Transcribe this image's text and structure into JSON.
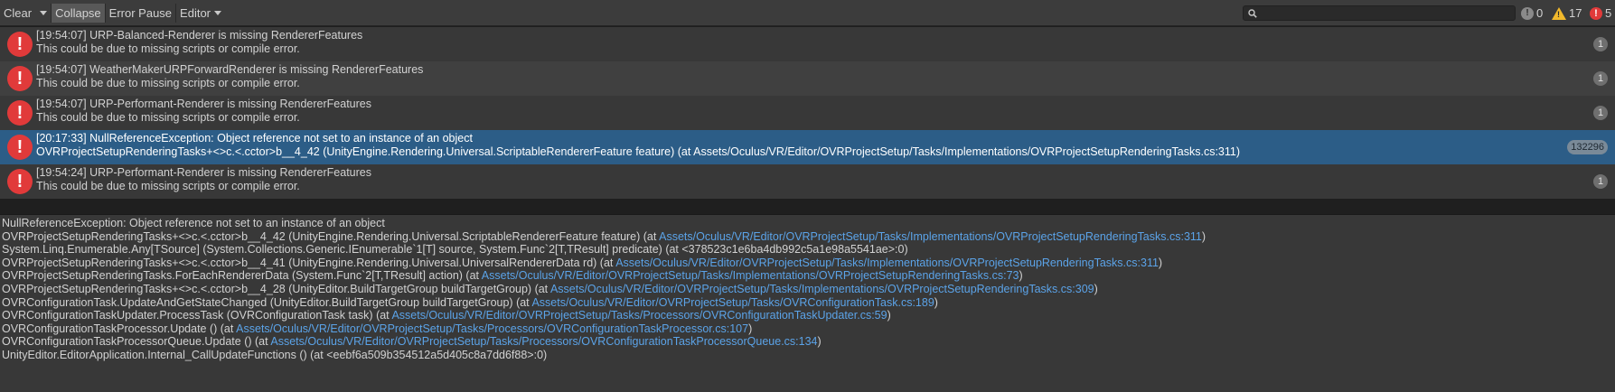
{
  "toolbar": {
    "clear_label": "Clear",
    "collapse_label": "Collapse",
    "error_pause_label": "Error Pause",
    "editor_label": "Editor",
    "search": {
      "value": "",
      "placeholder": ""
    },
    "counts": {
      "info": "0",
      "warnings": "17",
      "errors": "5"
    }
  },
  "logs": [
    {
      "line1": "[19:54:07] URP-Balanced-Renderer is missing RendererFeatures",
      "line2": "This could be due to missing scripts or compile error.",
      "count": "1",
      "selected": false
    },
    {
      "line1": "[19:54:07] WeatherMakerURPForwardRenderer is missing RendererFeatures",
      "line2": "This could be due to missing scripts or compile error.",
      "count": "1",
      "selected": false
    },
    {
      "line1": "[19:54:07] URP-Performant-Renderer is missing RendererFeatures",
      "line2": "This could be due to missing scripts or compile error.",
      "count": "1",
      "selected": false
    },
    {
      "line1": "[20:17:33] NullReferenceException: Object reference not set to an instance of an object",
      "line2": "OVRProjectSetupRenderingTasks+<>c.<.cctor>b__4_42 (UnityEngine.Rendering.Universal.ScriptableRendererFeature feature) (at Assets/Oculus/VR/Editor/OVRProjectSetup/Tasks/Implementations/OVRProjectSetupRenderingTasks.cs:311)",
      "count": "132296",
      "selected": true
    },
    {
      "line1": "[19:54:24] URP-Performant-Renderer is missing RendererFeatures",
      "line2": "This could be due to missing scripts or compile error.",
      "count": "1",
      "selected": false
    }
  ],
  "detail": [
    {
      "text": "NullReferenceException: Object reference not set to an instance of an object",
      "link": "",
      "suffix": ""
    },
    {
      "text": "OVRProjectSetupRenderingTasks+<>c.<.cctor>b__4_42 (UnityEngine.Rendering.Universal.ScriptableRendererFeature feature) (at ",
      "link": "Assets/Oculus/VR/Editor/OVRProjectSetup/Tasks/Implementations/OVRProjectSetupRenderingTasks.cs:311",
      "suffix": ")"
    },
    {
      "text": "System.Linq.Enumerable.Any[TSource] (System.Collections.Generic.IEnumerable`1[T] source, System.Func`2[T,TResult] predicate) (at <378523c1e6ba4db992c5a1e98a5541ae>:0)",
      "link": "",
      "suffix": ""
    },
    {
      "text": "OVRProjectSetupRenderingTasks+<>c.<.cctor>b__4_41 (UnityEngine.Rendering.Universal.UniversalRendererData rd) (at ",
      "link": "Assets/Oculus/VR/Editor/OVRProjectSetup/Tasks/Implementations/OVRProjectSetupRenderingTasks.cs:311",
      "suffix": ")"
    },
    {
      "text": "OVRProjectSetupRenderingTasks.ForEachRendererData (System.Func`2[T,TResult] action) (at ",
      "link": "Assets/Oculus/VR/Editor/OVRProjectSetup/Tasks/Implementations/OVRProjectSetupRenderingTasks.cs:73",
      "suffix": ")"
    },
    {
      "text": "OVRProjectSetupRenderingTasks+<>c.<.cctor>b__4_28 (UnityEditor.BuildTargetGroup buildTargetGroup) (at ",
      "link": "Assets/Oculus/VR/Editor/OVRProjectSetup/Tasks/Implementations/OVRProjectSetupRenderingTasks.cs:309",
      "suffix": ")"
    },
    {
      "text": "OVRConfigurationTask.UpdateAndGetStateChanged (UnityEditor.BuildTargetGroup buildTargetGroup) (at ",
      "link": "Assets/Oculus/VR/Editor/OVRProjectSetup/Tasks/OVRConfigurationTask.cs:189",
      "suffix": ")"
    },
    {
      "text": "OVRConfigurationTaskUpdater.ProcessTask (OVRConfigurationTask task) (at ",
      "link": "Assets/Oculus/VR/Editor/OVRProjectSetup/Tasks/Processors/OVRConfigurationTaskUpdater.cs:59",
      "suffix": ")"
    },
    {
      "text": "OVRConfigurationTaskProcessor.Update () (at ",
      "link": "Assets/Oculus/VR/Editor/OVRProjectSetup/Tasks/Processors/OVRConfigurationTaskProcessor.cs:107",
      "suffix": ")"
    },
    {
      "text": "OVRConfigurationTaskProcessorQueue.Update () (at ",
      "link": "Assets/Oculus/VR/Editor/OVRProjectSetup/Tasks/Processors/OVRConfigurationTaskProcessorQueue.cs:134",
      "suffix": ")"
    },
    {
      "text": "UnityEditor.EditorApplication.Internal_CallUpdateFunctions () (at <eebf6a509b354512a5d405c8a7dd6f88>:0)",
      "link": "",
      "suffix": ""
    }
  ],
  "icons": {
    "error": "!",
    "colors": {
      "error": "#e13a3a",
      "warning": "#f2b92c",
      "info": "#8a8a8a",
      "link": "#5ba3e8",
      "selected_row": "#2c5d87"
    }
  }
}
